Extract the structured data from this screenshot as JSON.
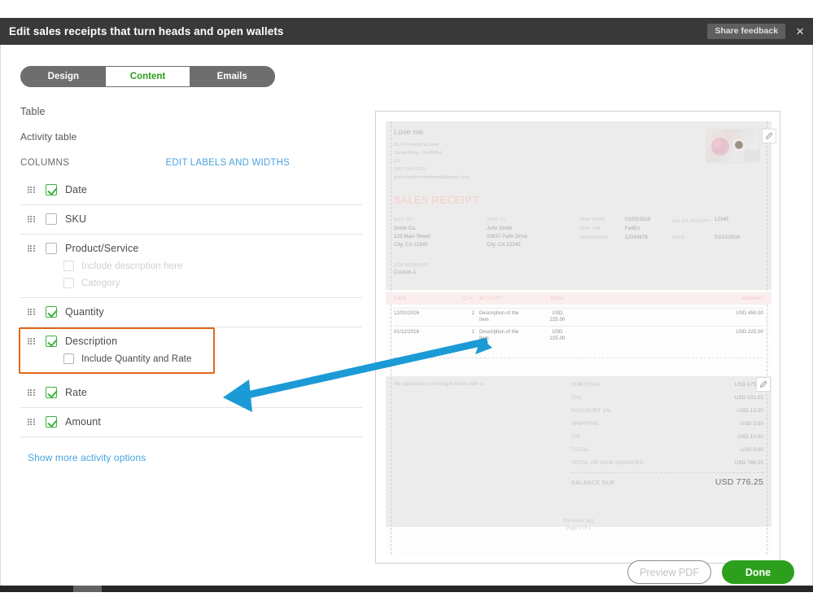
{
  "window": {
    "title": "Edit sales receipts that turn heads and open wallets",
    "share_feedback_label": "Share feedback",
    "close_label": "×"
  },
  "tabs": [
    {
      "label": "Design",
      "active": false
    },
    {
      "label": "Content",
      "active": true
    },
    {
      "label": "Emails",
      "active": false
    }
  ],
  "left_panel": {
    "section_title": "Table",
    "section_sub": "Activity table",
    "columns_label": "COLUMNS",
    "edit_link": "EDIT LABELS AND WIDTHS",
    "show_more": "Show more activity options",
    "columns": [
      {
        "label": "Date",
        "checked": true,
        "sub": []
      },
      {
        "label": "SKU",
        "checked": false,
        "sub": []
      },
      {
        "label": "Product/Service",
        "checked": false,
        "sub": [
          {
            "label": "Include description here",
            "checked": false,
            "disabled": true
          },
          {
            "label": "Category",
            "checked": false,
            "disabled": true
          }
        ]
      },
      {
        "label": "Quantity",
        "checked": true,
        "sub": []
      },
      {
        "label": "Description",
        "checked": true,
        "highlighted": true,
        "sub": [
          {
            "label": "Include Quantity and Rate",
            "checked": false,
            "disabled": false
          }
        ]
      },
      {
        "label": "Rate",
        "checked": true,
        "sub": []
      },
      {
        "label": "Amount",
        "checked": true,
        "sub": []
      }
    ]
  },
  "preview": {
    "business": {
      "name": "Love me",
      "address1": "2574  Friendship Lane",
      "address2": "Santa Clara, CA 95054",
      "country": "US",
      "phone": "(987) 654-3210",
      "email": "pretty.businesstestemail@gmail.com"
    },
    "doc_title": "SALES RECEIPT",
    "bill_to": {
      "label": "BILL TO",
      "line1": "Smith Co.",
      "line2": "123 Main Street",
      "line3": "City, CA 12345"
    },
    "ship_to": {
      "label": "SHIP TO",
      "line1": "John Smith",
      "line2": "20537 Palm Drive",
      "line3": "City, CA 12345"
    },
    "shipping_meta": [
      {
        "label": "SHIP DATE",
        "value": "01/03/2015"
      },
      {
        "label": "SHIP VIA",
        "value": "FedEx"
      },
      {
        "label": "TRACKING#",
        "value": "12345678"
      }
    ],
    "doc_meta": [
      {
        "label": "SALES RECEIPT",
        "value": "12345"
      },
      {
        "label": "DATE",
        "value": "01/12/2016"
      }
    ],
    "job_address": {
      "label": "JOB ADDRESS",
      "value": "Custom-1"
    },
    "table": {
      "headers": [
        "DATE",
        "QTY",
        "ACTIVITY",
        "RATE",
        "AMOUNT"
      ],
      "rows": [
        {
          "date": "12/01/2016",
          "qty": "2",
          "activity": "Description of the item",
          "rate": "USD 225.00",
          "amount": "USD 450.00"
        },
        {
          "date": "01/12/2016",
          "qty": "1",
          "activity": "Description of the item",
          "rate": "USD 225.00",
          "amount": "USD 225.00"
        }
      ]
    },
    "memo": "We appreciate you doing business with u.",
    "totals": [
      {
        "label": "SUBTOTAL",
        "value": "USD 675.00"
      },
      {
        "label": "TAX",
        "value": "USD 101.25"
      },
      {
        "label": "DISCOUNT 2%",
        "value": "-USD 13.50"
      },
      {
        "label": "SHIPPING",
        "value": "USD 3.50"
      },
      {
        "label": "TIP",
        "value": "USD 10.00"
      },
      {
        "label": "TOTAL",
        "value": "USD 0.00"
      },
      {
        "label": "TOTAL OF NEW CHARGES",
        "value": "USD 766.25"
      }
    ],
    "balance_due": {
      "label": "BALANCE DUE",
      "value": "USD 776.25"
    },
    "footer_note": "the footer tag)",
    "page_number": "Page 1 of 1"
  },
  "footer": {
    "preview_pdf_label": "Preview PDF",
    "done_label": "Done"
  },
  "colors": {
    "accent_green": "#2ca01c",
    "link_blue": "#4aa3df",
    "highlight_orange": "#e2661a",
    "arrow_blue": "#1b9ad6",
    "titlebar": "#393939"
  }
}
